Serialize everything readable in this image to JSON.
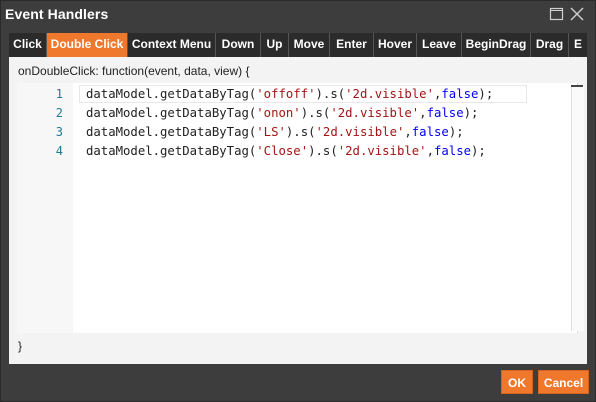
{
  "window": {
    "title": "Event Handlers"
  },
  "tabs": [
    {
      "label": "Click",
      "active": false
    },
    {
      "label": "Double Click",
      "active": true
    },
    {
      "label": "Context Menu",
      "active": false
    },
    {
      "label": "Down",
      "active": false
    },
    {
      "label": "Up",
      "active": false
    },
    {
      "label": "Move",
      "active": false
    },
    {
      "label": "Enter",
      "active": false
    },
    {
      "label": "Hover",
      "active": false
    },
    {
      "label": "Leave",
      "active": false
    },
    {
      "label": "BeginDrag",
      "active": false
    },
    {
      "label": "Drag",
      "active": false
    },
    {
      "label": "E",
      "active": false
    }
  ],
  "editor": {
    "signature": "onDoubleClick: function(event, data, view) {",
    "closing": "}",
    "lines": [
      {
        "num": "1",
        "prefix": "dataModel.getDataByTag(",
        "tag": "'offoff'",
        "mid": ").s(",
        "key": "'2d.visible'",
        "comma": ",",
        "val": "false",
        "suffix": ");"
      },
      {
        "num": "2",
        "prefix": "dataModel.getDataByTag(",
        "tag": "'onon'",
        "mid": ").s(",
        "key": "'2d.visible'",
        "comma": ",",
        "val": "false",
        "suffix": ");"
      },
      {
        "num": "3",
        "prefix": "dataModel.getDataByTag(",
        "tag": "'LS'",
        "mid": ").s(",
        "key": "'2d.visible'",
        "comma": ",",
        "val": "false",
        "suffix": ");"
      },
      {
        "num": "4",
        "prefix": "dataModel.getDataByTag(",
        "tag": "'Close'",
        "mid": ").s(",
        "key": "'2d.visible'",
        "comma": ",",
        "val": "false",
        "suffix": ");"
      }
    ]
  },
  "buttons": {
    "ok": "OK",
    "cancel": "Cancel"
  },
  "colors": {
    "accent": "#f0782d",
    "title_bg": "#3d3d3d",
    "tab_bg": "#2b2b2b",
    "string": "#a31515",
    "keyword": "#0000ff",
    "line_number": "#237893"
  }
}
